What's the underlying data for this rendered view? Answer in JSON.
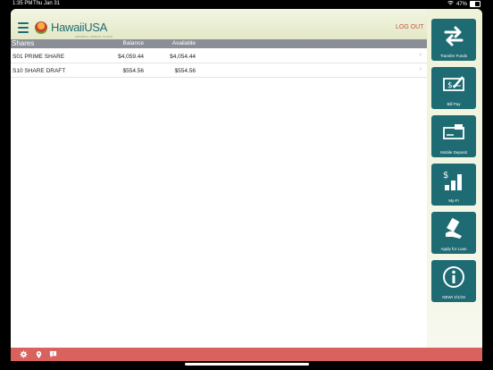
{
  "status_bar": {
    "time": "1:35 PM",
    "day": "Thu Jan 31",
    "battery": "47%",
    "battery_level": 0.47
  },
  "header": {
    "logo_text": "HawaiiUSA",
    "logo_sub": "FEDERAL CREDIT UNION",
    "logout_label": "LOG OUT"
  },
  "table": {
    "section_title": "Shares",
    "columns": {
      "balance": "Balance",
      "available": "Available"
    },
    "rows": [
      {
        "name": "S01 PRIME SHARE",
        "balance": "$4,059.44",
        "available": "$4,054.44"
      },
      {
        "name": "S10 SHARE DRAFT",
        "balance": "$554.56",
        "available": "$554.56"
      }
    ]
  },
  "sidebar": {
    "tiles": [
      {
        "label": "Transfer Funds",
        "icon": "transfer-arrows-icon"
      },
      {
        "label": "Bill Pay",
        "icon": "bill-pay-check-icon"
      },
      {
        "label": "Mobile Deposit",
        "icon": "mobile-deposit-check-icon"
      },
      {
        "label": "My-Fi",
        "icon": "dollar-bar-chart-icon"
      },
      {
        "label": "Apply for Loan",
        "icon": "hand-money-icon"
      },
      {
        "label": "NEW! 2/1/19",
        "icon": "info-icon"
      }
    ]
  },
  "footer": {
    "icons": [
      "settings-icon",
      "location-pin-icon",
      "chat-icon"
    ]
  },
  "colors": {
    "teal": "#1f6b73",
    "footer": "#d9615e",
    "logout": "#c9533f",
    "table_header": "#8a8f97"
  }
}
